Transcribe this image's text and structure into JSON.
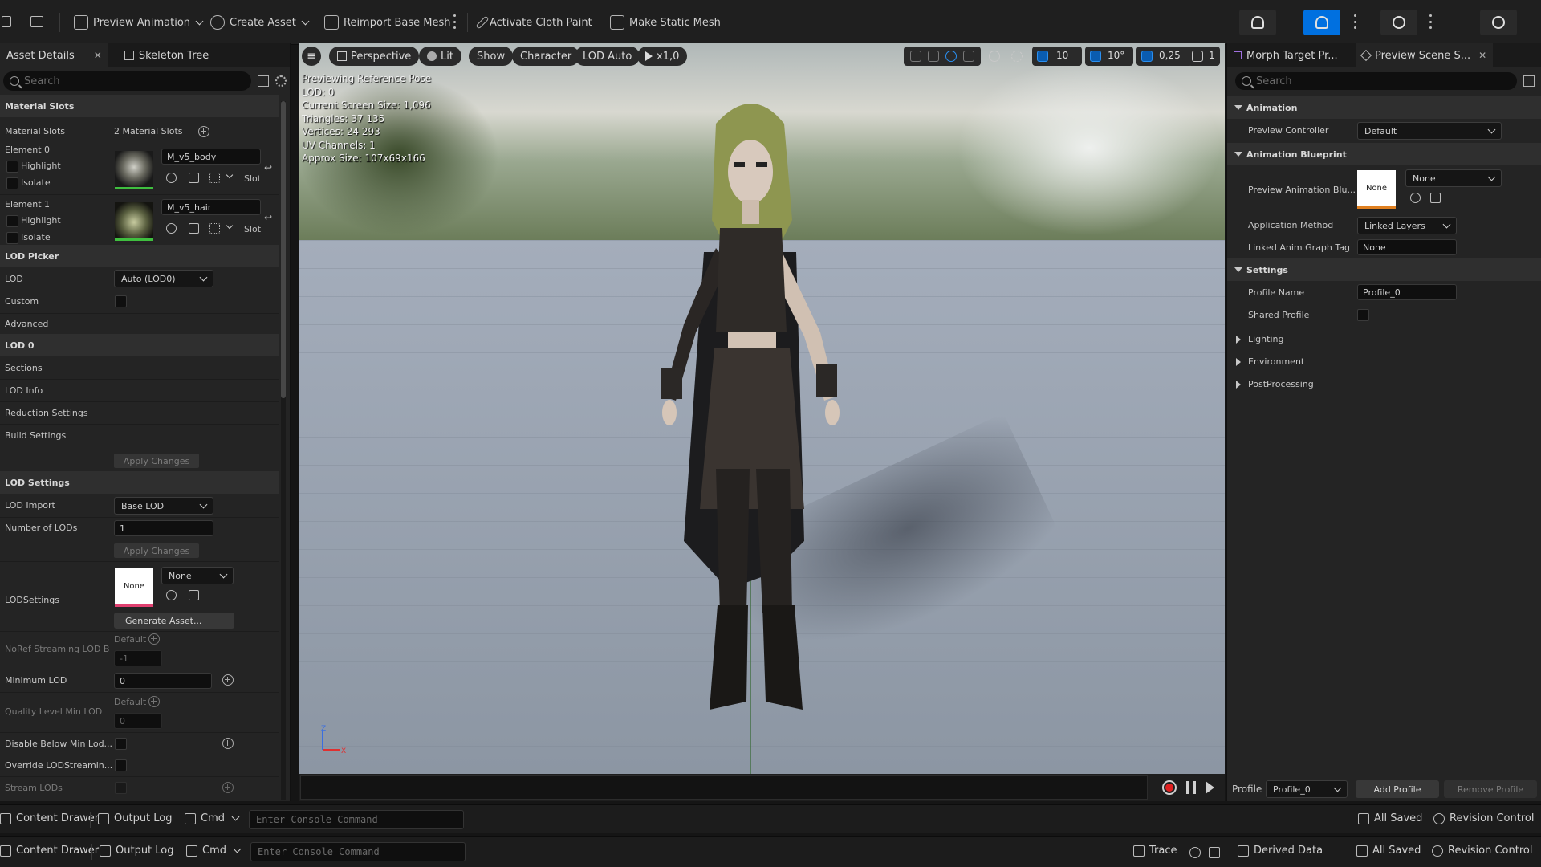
{
  "toolbar": {
    "preview_animation": "Preview Animation",
    "create_asset": "Create Asset",
    "reimport_base_mesh": "Reimport Base Mesh",
    "activate_cloth_paint": "Activate Cloth Paint",
    "make_static_mesh": "Make Static Mesh"
  },
  "left_panel": {
    "tabs": [
      {
        "label": "Asset Details",
        "active": true
      },
      {
        "label": "Skeleton Tree",
        "active": false
      }
    ],
    "search_placeholder": "Search",
    "material_slots_header": "Material Slots",
    "material_slots_label": "Material Slots",
    "material_slots_value": "2 Material Slots",
    "elements": [
      {
        "label": "Element 0",
        "material": "M_v5_body",
        "highlight": "Highlight",
        "isolate": "Isolate",
        "slot": "Slot"
      },
      {
        "label": "Element 1",
        "material": "M_v5_hair",
        "highlight": "Highlight",
        "isolate": "Isolate",
        "slot": "Slot"
      }
    ],
    "lod_picker_header": "LOD Picker",
    "lod_label": "LOD",
    "lod_value": "Auto (LOD0)",
    "custom_label": "Custom",
    "advanced_label": "Advanced",
    "lod0_header": "LOD 0",
    "sections_label": "Sections",
    "lod_info_label": "LOD Info",
    "reduction_settings_label": "Reduction Settings",
    "build_settings_label": "Build Settings",
    "apply_changes": "Apply Changes",
    "lod_settings_header": "LOD Settings",
    "lod_import_label": "LOD Import",
    "lod_import_value": "Base LOD",
    "number_of_lods_label": "Number of LODs",
    "number_of_lods_value": "1",
    "apply_changes_2": "Apply Changes",
    "lodsettings_label": "LODSettings",
    "lodsettings_thumb": "None",
    "lodsettings_value": "None",
    "generate_asset": "Generate Asset...",
    "noref_label": "NoRef Streaming LOD B",
    "noref_default": "Default",
    "noref_value": "-1",
    "minimum_lod_label": "Minimum LOD",
    "minimum_lod_value": "0",
    "quality_level_label": "Quality Level Min LOD",
    "quality_default": "Default",
    "quality_value": "0",
    "disable_below_label": "Disable Below Min Lod...",
    "override_label": "Override LODStreamin...",
    "stream_lods_label": "Stream LODs"
  },
  "viewport": {
    "perspective": "Perspective",
    "lit": "Lit",
    "show": "Show",
    "character": "Character",
    "lod_auto": "LOD Auto",
    "play_speed": "x1,0",
    "grid_snap": "10",
    "rot_snap": "10°",
    "scale_snap": "0,25",
    "camera_speed": "1",
    "stats": [
      "Previewing Reference Pose",
      "LOD: 0",
      "Current Screen Size: 1,096",
      "Triangles: 37 135",
      "Vertices: 24 293",
      "UV Channels: 1",
      "Approx Size: 107x69x166"
    ],
    "axis_z": "Z",
    "axis_x": "X"
  },
  "right_panel": {
    "tabs": [
      {
        "label": "Morph Target Pr...",
        "active": false
      },
      {
        "label": "Preview Scene S...",
        "active": true
      }
    ],
    "search_placeholder": "Search",
    "animation_header": "Animation",
    "preview_controller_label": "Preview Controller",
    "preview_controller_value": "Default",
    "anim_blueprint_header": "Animation Blueprint",
    "preview_anim_bp_label": "Preview Animation Blu...",
    "preview_anim_bp_thumb": "None",
    "preview_anim_bp_value": "None",
    "application_method_label": "Application Method",
    "application_method_value": "Linked Layers",
    "linked_anim_graph_label": "Linked Anim Graph Tag",
    "linked_anim_graph_value": "None",
    "settings_header": "Settings",
    "profile_name_label": "Profile Name",
    "profile_name_value": "Profile_0",
    "shared_profile_label": "Shared Profile",
    "lighting": "Lighting",
    "environment": "Environment",
    "postprocessing": "PostProcessing",
    "profile_label": "Profile",
    "profile_value": "Profile_0",
    "add_profile": "Add Profile",
    "remove_profile": "Remove Profile"
  },
  "bottom_bar_1": {
    "content_drawer": "Content Drawer",
    "output_log": "Output Log",
    "cmd": "Cmd",
    "console_placeholder": "Enter Console Command",
    "all_saved": "All Saved",
    "revision_control": "Revision Control"
  },
  "bottom_bar_2": {
    "content_drawer": "Content Drawer",
    "output_log": "Output Log",
    "cmd": "Cmd",
    "console_placeholder": "Enter Console Command",
    "trace": "Trace",
    "derived_data": "Derived Data",
    "all_saved": "All Saved",
    "revision_control": "Revision Control"
  },
  "colors": {
    "accent": "#0070e0",
    "record": "#e02020",
    "material_ok": "#3fbf3f"
  }
}
